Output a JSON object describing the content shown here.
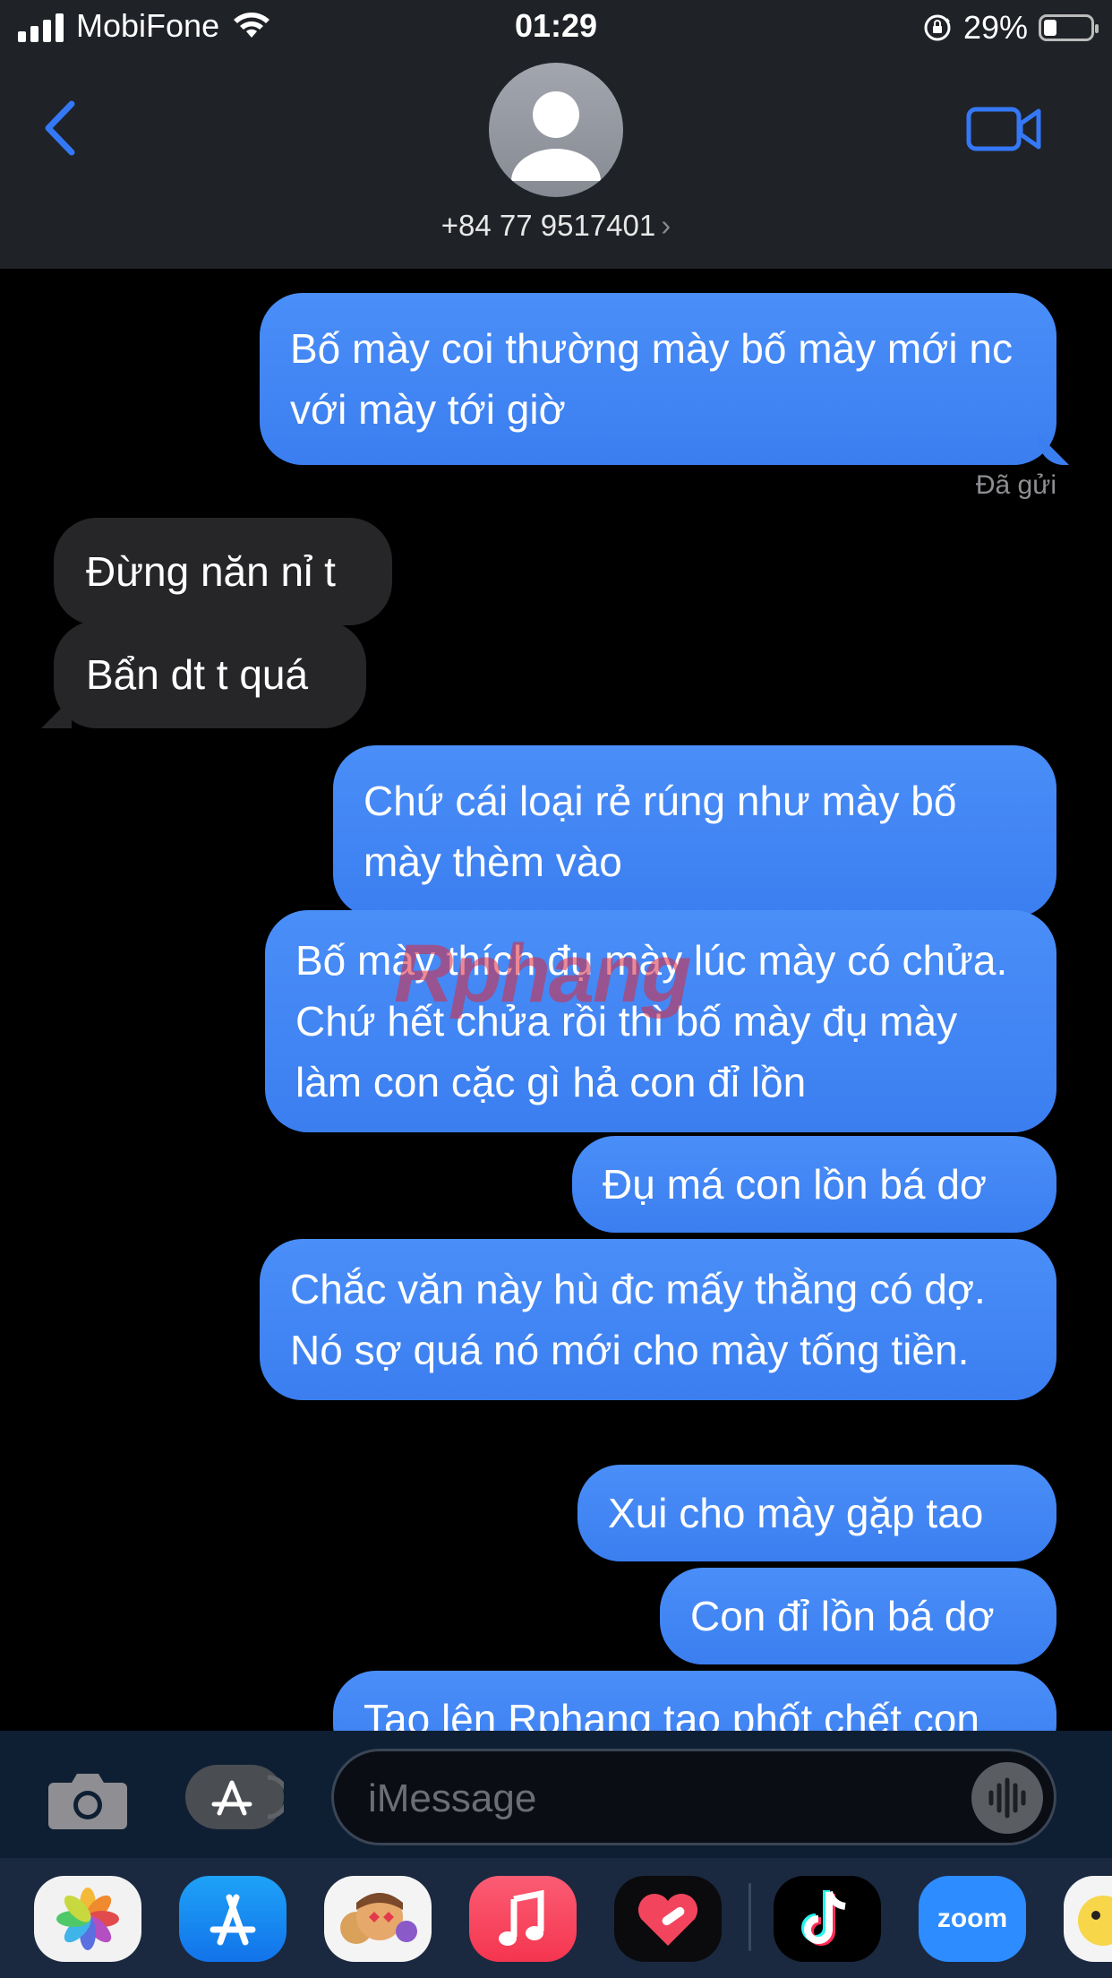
{
  "status_bar": {
    "carrier": "MobiFone",
    "time": "01:29",
    "battery": "29%",
    "battery_level": 0.29
  },
  "header": {
    "contact": "+84 77 9517401",
    "chevron": "›",
    "back_icon": "chevron-left-icon",
    "video_icon": "video-camera-icon"
  },
  "messages": [
    {
      "text": "Bố mày coi thường mày bố mày mới nc với mày tới giờ",
      "from": "me"
    },
    {
      "text": "Đừng năn nỉ t",
      "from": "them"
    },
    {
      "text": "Bẩn dt t quá",
      "from": "them"
    },
    {
      "text": "Chứ cái loại rẻ rúng như mày bố mày thèm vào",
      "from": "me"
    },
    {
      "text": "Bố mày thích đụ mày lúc mày có chửa. Chứ hết chửa rồi thì bố mày đụ mày làm con cặc gì hả con đỉ lồn",
      "from": "me"
    },
    {
      "text": "Đụ má con lồn bá dơ",
      "from": "me"
    },
    {
      "text": "Chắc văn này hù đc mấy thằng có dợ. Nó sợ quá nó mới cho mày tống tiền.",
      "from": "me"
    },
    {
      "text": "Xui cho mày gặp tao",
      "from": "me"
    },
    {
      "text": "Con đỉ lồn bá dơ",
      "from": "me"
    },
    {
      "text": "Tao lên Rphang tao phốt chết con",
      "from": "me"
    }
  ],
  "delivered": "Đã gửi",
  "watermark": "Rphang",
  "compose": {
    "placeholder": "iMessage",
    "camera_icon": "camera-icon",
    "apps_icon": "app-store-icon",
    "mic_icon": "audio-waveform-icon"
  },
  "drawer": {
    "apps": [
      "photos-icon",
      "app-store-icon",
      "memoji-icon",
      "music-icon",
      "heart-app-icon",
      "tiktok-icon",
      "zoom-icon",
      "sticker-icon"
    ],
    "zoom_label": "zoom"
  },
  "colors": {
    "bubble_out": "#3b7ef0",
    "bubble_in": "#262628",
    "header_bg": "#1f2227",
    "accent": "#3478f6"
  }
}
